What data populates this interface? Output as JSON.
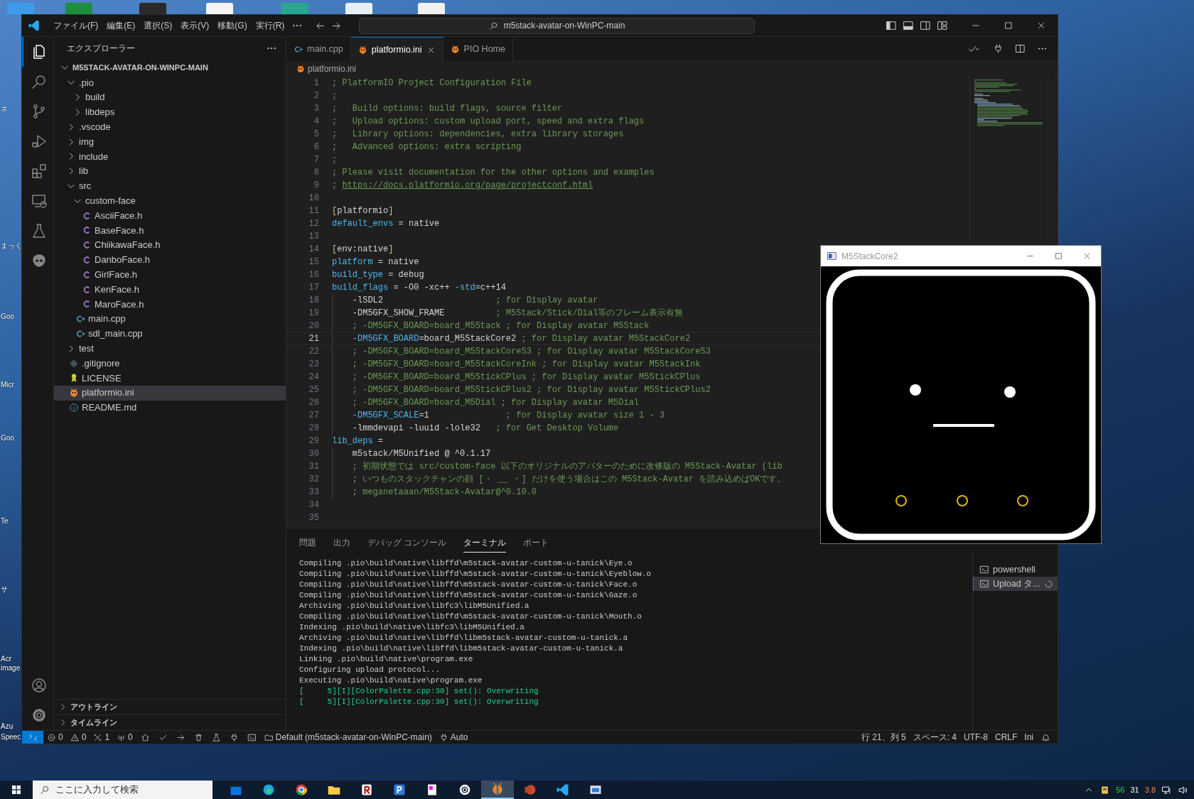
{
  "desktop": {
    "top_icons": [
      {
        "kind": "blue"
      },
      {
        "kind": "green"
      },
      {
        "kind": "red"
      },
      {
        "kind": "notepad"
      },
      {
        "kind": "teal"
      },
      {
        "kind": "doc"
      },
      {
        "kind": "orange"
      }
    ],
    "icon_labels": [
      "ネ",
      "まっく",
      "Goo",
      "Micr",
      "Goo",
      "Te",
      "サ",
      "Acr",
      "image",
      "Azu",
      "Speec"
    ]
  },
  "window": {
    "menu": [
      "ファイル(F)",
      "編集(E)",
      "選択(S)",
      "表示(V)",
      "移動(G)",
      "実行(R)"
    ],
    "command_center": {
      "text": "m5stack-avatar-on-WinPC-main"
    }
  },
  "activity_bar": {
    "top": [
      {
        "kind": "explorer",
        "selected": true
      },
      {
        "kind": "search",
        "selected": false
      },
      {
        "kind": "source-control",
        "selected": false
      },
      {
        "kind": "run-debug",
        "selected": false
      },
      {
        "kind": "extensions",
        "selected": false
      },
      {
        "kind": "remote",
        "selected": false
      },
      {
        "kind": "testing",
        "selected": false
      },
      {
        "kind": "platformio",
        "selected": false
      }
    ],
    "bottom": [
      {
        "kind": "account"
      },
      {
        "kind": "settings"
      }
    ]
  },
  "explorer": {
    "title": "エクスプローラー",
    "tree": [
      {
        "label": "M5STACK-AVATAR-ON-WINPC-MAIN",
        "kind": "root",
        "expanded": true,
        "selected": false,
        "children": [
          {
            "label": ".pio",
            "kind": "folder",
            "expanded": true,
            "selected": false,
            "children": [
              {
                "label": "build",
                "kind": "folder",
                "expanded": false,
                "selected": false
              },
              {
                "label": "libdeps",
                "kind": "folder",
                "expanded": false,
                "selected": false
              }
            ]
          },
          {
            "label": ".vscode",
            "kind": "folder",
            "expanded": false,
            "selected": false
          },
          {
            "label": "img",
            "kind": "folder",
            "expanded": false,
            "selected": false
          },
          {
            "label": "include",
            "kind": "folder",
            "expanded": false,
            "selected": false
          },
          {
            "label": "lib",
            "kind": "folder",
            "expanded": false,
            "selected": false
          },
          {
            "label": "src",
            "kind": "folder",
            "expanded": true,
            "selected": false,
            "children": [
              {
                "label": "custom-face",
                "kind": "folder",
                "expanded": true,
                "selected": false,
                "children": [
                  {
                    "label": "AsciiFace.h",
                    "kind": "c-header",
                    "selected": false
                  },
                  {
                    "label": "BaseFace.h",
                    "kind": "c-header",
                    "selected": false
                  },
                  {
                    "label": "ChiikawaFace.h",
                    "kind": "c-header",
                    "selected": false
                  },
                  {
                    "label": "DanboFace.h",
                    "kind": "c-header",
                    "selected": false
                  },
                  {
                    "label": "GirlFace.h",
                    "kind": "c-header",
                    "selected": false
                  },
                  {
                    "label": "KenFace.h",
                    "kind": "c-header",
                    "selected": false
                  },
                  {
                    "label": "MaroFace.h",
                    "kind": "c-header",
                    "selected": false
                  }
                ]
              },
              {
                "label": "main.cpp",
                "kind": "cpp",
                "selected": false
              },
              {
                "label": "sdl_main.cpp",
                "kind": "cpp",
                "selected": false
              }
            ]
          },
          {
            "label": "test",
            "kind": "folder",
            "expanded": false,
            "selected": false
          },
          {
            "label": ".gitignore",
            "kind": "git",
            "selected": false
          },
          {
            "label": "LICENSE",
            "kind": "license",
            "selected": false
          },
          {
            "label": "platformio.ini",
            "kind": "platformio",
            "selected": true
          },
          {
            "label": "README.md",
            "kind": "info",
            "selected": false
          }
        ]
      }
    ],
    "sections": [
      {
        "label": "アウトライン",
        "expanded": false
      },
      {
        "label": "タイムライン",
        "expanded": false
      }
    ]
  },
  "editor": {
    "tabs": [
      {
        "label": "main.cpp",
        "kind": "cpp",
        "selected": false
      },
      {
        "label": "platformio.ini",
        "kind": "platformio",
        "selected": true
      },
      {
        "label": "PIO Home",
        "kind": "platformio",
        "selected": false
      }
    ],
    "breadcrumb": "platformio.ini",
    "lines": [
      {
        "number": "1",
        "current": false,
        "indented": false,
        "segments": [
          {
            "kind": "comment",
            "text": "; PlatformIO Project Configuration File"
          }
        ]
      },
      {
        "number": "2",
        "current": false,
        "indented": false,
        "segments": [
          {
            "kind": "comment",
            "text": ";"
          }
        ]
      },
      {
        "number": "3",
        "current": false,
        "indented": false,
        "segments": [
          {
            "kind": "comment",
            "text": ";   Build options: build flags, source filter"
          }
        ]
      },
      {
        "number": "4",
        "current": false,
        "indented": false,
        "segments": [
          {
            "kind": "comment",
            "text": ";   Upload options: custom upload port, speed and extra flags"
          }
        ]
      },
      {
        "number": "5",
        "current": false,
        "indented": false,
        "segments": [
          {
            "kind": "comment",
            "text": ";   Library options: dependencies, extra library storages"
          }
        ]
      },
      {
        "number": "6",
        "current": false,
        "indented": false,
        "segments": [
          {
            "kind": "comment",
            "text": ";   Advanced options: extra scripting"
          }
        ]
      },
      {
        "number": "7",
        "current": false,
        "indented": false,
        "segments": [
          {
            "kind": "comment",
            "text": ";"
          }
        ]
      },
      {
        "number": "8",
        "current": false,
        "indented": false,
        "segments": [
          {
            "kind": "comment",
            "text": "; Please visit documentation for the other options and examples"
          }
        ]
      },
      {
        "number": "9",
        "current": false,
        "indented": false,
        "segments": [
          {
            "kind": "comment",
            "text": "; "
          },
          {
            "kind": "link",
            "text": "https://docs.platformio.org/page/projectconf.html"
          }
        ]
      },
      {
        "number": "10",
        "current": false,
        "indented": false
      },
      {
        "number": "11",
        "current": false,
        "indented": false,
        "segments": [
          {
            "kind": "bracket",
            "text": "["
          },
          {
            "kind": "value",
            "text": "platformio"
          },
          {
            "kind": "bracket",
            "text": "]"
          }
        ]
      },
      {
        "number": "12",
        "current": false,
        "indented": false,
        "segments": [
          {
            "kind": "key",
            "text": "default_envs"
          },
          {
            "kind": "value",
            "text": " = native"
          }
        ]
      },
      {
        "number": "13",
        "current": false,
        "indented": false
      },
      {
        "number": "14",
        "current": false,
        "indented": false,
        "segments": [
          {
            "kind": "bracket",
            "text": "["
          },
          {
            "kind": "value",
            "text": "env:native"
          },
          {
            "kind": "bracket",
            "text": "]"
          }
        ]
      },
      {
        "number": "15",
        "current": false,
        "indented": false,
        "segments": [
          {
            "kind": "key",
            "text": "platform"
          },
          {
            "kind": "value",
            "text": " = native"
          }
        ]
      },
      {
        "number": "16",
        "current": false,
        "indented": false,
        "segments": [
          {
            "kind": "key",
            "text": "build_type"
          },
          {
            "kind": "value",
            "text": " = debug"
          }
        ]
      },
      {
        "number": "17",
        "current": false,
        "indented": false,
        "segments": [
          {
            "kind": "key",
            "text": "build_flags"
          },
          {
            "kind": "value",
            "text": " = -O0 -xc++ "
          },
          {
            "kind": "key",
            "text": "-std"
          },
          {
            "kind": "value",
            "text": "=c++14"
          }
        ]
      },
      {
        "number": "18",
        "current": false,
        "indented": true,
        "segments": [
          {
            "kind": "value",
            "text": "-lSDL2                      "
          },
          {
            "kind": "comment",
            "text": "; for Display avatar"
          }
        ]
      },
      {
        "number": "19",
        "current": false,
        "indented": true,
        "segments": [
          {
            "kind": "value",
            "text": "-DM5GFX_SHOW_FRAME          "
          },
          {
            "kind": "comment",
            "text": "; M5Stack/Stick/Dial等のフレーム表示有無"
          }
        ]
      },
      {
        "number": "20",
        "current": false,
        "indented": true,
        "segments": [
          {
            "kind": "comment",
            "text": "; -DM5GFX_BOARD=board_M5Stack ; for Display avatar M5Stack"
          }
        ]
      },
      {
        "number": "21",
        "current": true,
        "indented": true,
        "segments": [
          {
            "kind": "key",
            "text": "-DM5GFX_BOARD"
          },
          {
            "kind": "value",
            "text": "=board_M5StackCore2 "
          },
          {
            "kind": "comment",
            "text": "; for Display avatar M5StackCore2"
          }
        ]
      },
      {
        "number": "22",
        "current": false,
        "indented": true,
        "segments": [
          {
            "kind": "comment",
            "text": "; -DM5GFX_BOARD=board_M5StackCoreS3 ; for Display avatar M5StackCoreS3"
          }
        ]
      },
      {
        "number": "23",
        "current": false,
        "indented": true,
        "segments": [
          {
            "kind": "comment",
            "text": "; -DM5GFX_BOARD=board_M5StackCoreInk ; for Display avatar M5StackInk"
          }
        ]
      },
      {
        "number": "24",
        "current": false,
        "indented": true,
        "segments": [
          {
            "kind": "comment",
            "text": "; -DM5GFX_BOARD=board_M5StickCPlus ; for Display avatar M5StickCPlus"
          }
        ]
      },
      {
        "number": "25",
        "current": false,
        "indented": true,
        "segments": [
          {
            "kind": "comment",
            "text": "; -DM5GFX_BOARD=board_M5StickCPlus2 ; for Display avatar M5StickCPlus2"
          }
        ]
      },
      {
        "number": "26",
        "current": false,
        "indented": true,
        "segments": [
          {
            "kind": "comment",
            "text": "; -DM5GFX_BOARD=board_M5Dial ; for Display avatar M5Dial"
          }
        ]
      },
      {
        "number": "27",
        "current": false,
        "indented": true,
        "segments": [
          {
            "kind": "key",
            "text": "-DM5GFX_SCALE"
          },
          {
            "kind": "value",
            "text": "=1               "
          },
          {
            "kind": "comment",
            "text": "; for Display avatar size 1 - 3"
          }
        ]
      },
      {
        "number": "28",
        "current": false,
        "indented": true,
        "segments": [
          {
            "kind": "value",
            "text": "-lmmdevapi -luuid -lole32   "
          },
          {
            "kind": "comment",
            "text": "; for Get Desktop Volume"
          }
        ]
      },
      {
        "number": "29",
        "current": false,
        "indented": false,
        "segments": [
          {
            "kind": "key",
            "text": "lib_deps"
          },
          {
            "kind": "value",
            "text": " ="
          }
        ]
      },
      {
        "number": "30",
        "current": false,
        "indented": true,
        "segments": [
          {
            "kind": "value",
            "text": "m5stack/M5Unified @ ^0.1.17"
          }
        ]
      },
      {
        "number": "31",
        "current": false,
        "indented": true,
        "segments": [
          {
            "kind": "comment",
            "text": "; 初期状態では src/custom-face 以下のオリジナルのアバターのために改修版の M5Stack-Avatar (lib"
          }
        ]
      },
      {
        "number": "32",
        "current": false,
        "indented": true,
        "segments": [
          {
            "kind": "comment",
            "text": "; いつものスタックチャンの顔 [・ __ ・] だけを使う場合はこの M5Stack-Avatar を読み込めばOKです。"
          }
        ]
      },
      {
        "number": "33",
        "current": false,
        "indented": true,
        "segments": [
          {
            "kind": "comment",
            "text": "; meganetaaan/M5Stack-Avatar@^0.10.0"
          }
        ]
      },
      {
        "number": "34",
        "current": false,
        "indented": false
      },
      {
        "number": "35",
        "current": false,
        "indented": false
      }
    ]
  },
  "panel": {
    "tabs": [
      {
        "label": "問題",
        "selected": false
      },
      {
        "label": "出力",
        "selected": false
      },
      {
        "label": "デバッグ コンソール",
        "selected": false
      },
      {
        "label": "ターミナル",
        "selected": true
      },
      {
        "label": "ポート",
        "selected": false
      }
    ],
    "terminal_lines": [
      {
        "kind": "plain",
        "text": "Compiling .pio\\build\\native\\libffd\\m5stack-avatar-custom-u-tanick\\Eye.o"
      },
      {
        "kind": "plain",
        "text": "Compiling .pio\\build\\native\\libffd\\m5stack-avatar-custom-u-tanick\\Eyeblow.o"
      },
      {
        "kind": "plain",
        "text": "Compiling .pio\\build\\native\\libffd\\m5stack-avatar-custom-u-tanick\\Face.o"
      },
      {
        "kind": "plain",
        "text": "Compiling .pio\\build\\native\\libffd\\m5stack-avatar-custom-u-tanick\\Gaze.o"
      },
      {
        "kind": "plain",
        "text": "Archiving .pio\\build\\native\\libfc3\\libM5Unified.a"
      },
      {
        "kind": "plain",
        "text": "Compiling .pio\\build\\native\\libffd\\m5stack-avatar-custom-u-tanick\\Mouth.o"
      },
      {
        "kind": "plain",
        "text": "Indexing .pio\\build\\native\\libfc3\\libM5Unified.a"
      },
      {
        "kind": "plain",
        "text": "Archiving .pio\\build\\native\\libffd\\libm5stack-avatar-custom-u-tanick.a"
      },
      {
        "kind": "plain",
        "text": "Indexing .pio\\build\\native\\libffd\\libm5stack-avatar-custom-u-tanick.a"
      },
      {
        "kind": "plain",
        "text": "Linking .pio\\build\\native\\program.exe"
      },
      {
        "kind": "plain",
        "text": "Configuring upload protocol..."
      },
      {
        "kind": "plain",
        "text": "Executing .pio\\build\\native\\program.exe"
      },
      {
        "kind": "info",
        "text": "[     5][I][ColorPalette.cpp:30] set(): Overwriting"
      },
      {
        "kind": "info",
        "text": "[     5][I][ColorPalette.cpp:30] set(): Overwriting"
      }
    ],
    "terminals": [
      {
        "label": "powershell",
        "selected": false,
        "busy": false
      },
      {
        "label": "Upload タ...",
        "selected": true,
        "busy": true
      }
    ]
  },
  "status_bar": {
    "left": [
      {
        "kind": "remote"
      },
      {
        "kind": "errors",
        "text": "0"
      },
      {
        "kind": "warnings",
        "text": "0"
      },
      {
        "kind": "tools",
        "text": "1"
      },
      {
        "kind": "radio",
        "text": "0"
      },
      {
        "kind": "home"
      },
      {
        "kind": "check"
      },
      {
        "kind": "arrow"
      },
      {
        "kind": "trash"
      },
      {
        "kind": "flask"
      },
      {
        "kind": "plug"
      },
      {
        "kind": "terminal"
      },
      {
        "kind": "folder",
        "text": "Default (m5stack-avatar-on-WinPC-main)"
      },
      {
        "kind": "plug",
        "text": "Auto"
      }
    ],
    "right": [
      {
        "kind": "text",
        "text": "行 21、列 5"
      },
      {
        "kind": "text",
        "text": "スペース: 4"
      },
      {
        "kind": "text",
        "text": "UTF-8"
      },
      {
        "kind": "text",
        "text": "CRLF"
      },
      {
        "kind": "text",
        "text": "Ini"
      },
      {
        "kind": "bell"
      }
    ]
  },
  "app_window": {
    "title": "M5StackCore2"
  },
  "taskbar": {
    "search_placeholder": "ここに入力して検索",
    "apps": [
      {
        "kind": "store",
        "active": false
      },
      {
        "kind": "edge",
        "active": false
      },
      {
        "kind": "chrome",
        "active": false
      },
      {
        "kind": "files",
        "active": false
      },
      {
        "kind": "red-app",
        "active": false
      },
      {
        "kind": "blue-app",
        "active": false
      },
      {
        "kind": "notepad",
        "active": false
      },
      {
        "kind": "settings",
        "active": false
      },
      {
        "kind": "platformio",
        "active": true
      },
      {
        "kind": "powerpoint",
        "active": false
      },
      {
        "kind": "vscode",
        "active": false
      },
      {
        "kind": "window",
        "active": false
      }
    ],
    "readings": [
      {
        "text": "56",
        "color": "#3fd13f"
      },
      {
        "text": "31",
        "color": "#ffffff"
      },
      {
        "text": "3.8",
        "color": "#f0843c"
      }
    ]
  }
}
